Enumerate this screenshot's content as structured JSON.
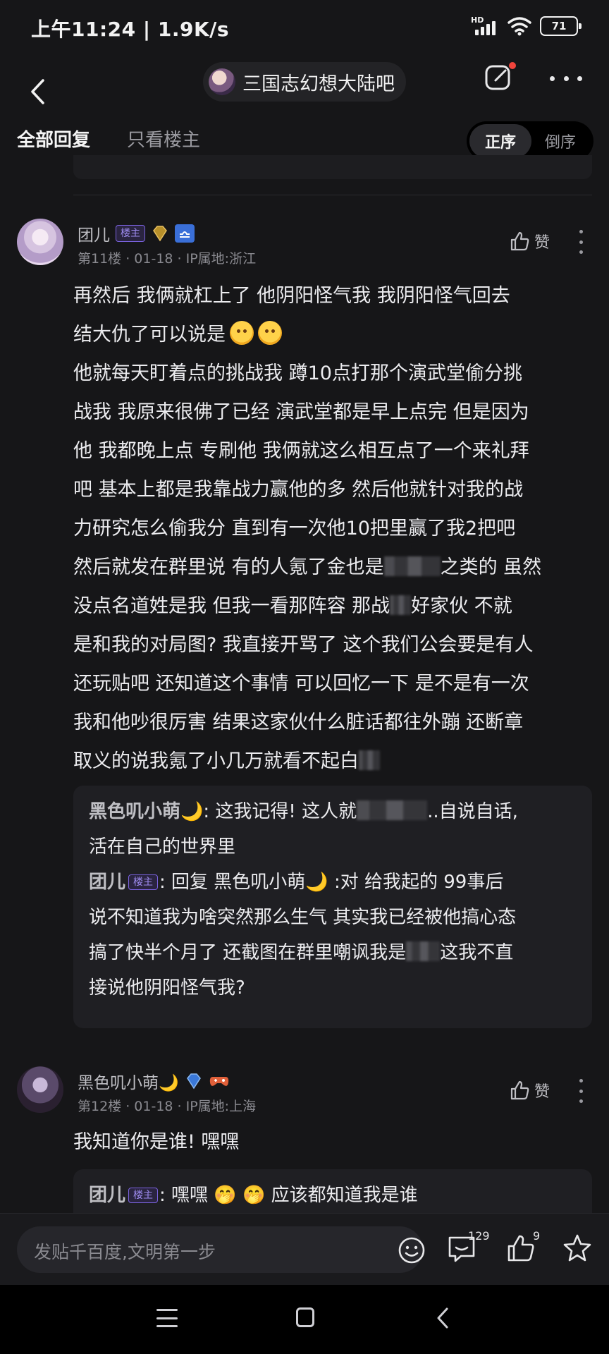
{
  "status": {
    "time_speed": "上午11:24 | 1.9K/s",
    "signal_label": "HD",
    "battery": "71"
  },
  "nav": {
    "forum_name": "三国志幻想大陆吧",
    "back_icon": "chevron-left-icon",
    "edit_icon": "edit-icon",
    "more_icon": "more-icon"
  },
  "tabs": {
    "all": "全部回复",
    "op_only": "只看楼主",
    "asc": "正序",
    "desc": "倒序"
  },
  "posts": [
    {
      "username": "团儿",
      "op_badge": "楼主",
      "meta": "第11楼 · 01-18 · IP属地:浙江",
      "like": "赞",
      "lines": [
        "再然后 我俩就杠上了 他阴阳怪气我 我阴阳怪气回去",
        "结大仇了可以说是",
        "他就每天盯着点的挑战我 蹲10点打那个演武堂偷分挑",
        "战我 我原来很佛了已经 演武堂都是早上点完 但是因为",
        "他 我都晚上点 专刷他 我俩就这么相互点了一个来礼拜",
        "吧 基本上都是我靠战力赢他的多 然后他就针对我的战",
        "力研究怎么偷我分 直到有一次他10把里赢了我2把吧",
        "然后就发在群里说 有的人氪了金也是",
        "之类的 虽然",
        "没点名道姓是我 但我一看那阵容 那战",
        "好家伙 不就",
        "是和我的对局图? 我直接开骂了 这个我们公会要是有人",
        "还玩贴吧 还知道这个事情 可以回忆一下 是不是有一次",
        "我和他吵很厉害 结果这家伙什么脏话都往外蹦 还断章",
        "取义的说我氪了小几万就看不起白"
      ],
      "replies": [
        {
          "name": "黑色叽小萌🌙",
          "text_a": ": 这我记得! 这人就",
          "text_b": "..自说自话,",
          "text_c": "活在自己的世界里"
        },
        {
          "name": "团儿",
          "badge": "楼主",
          "text_a": ": 回复 黑色叽小萌🌙 :对 给我起的 99事后",
          "text_b": "说不知道我为啥突然那么生气 其实我已经被他搞心态",
          "text_c": "搞了快半个月了 还截图在群里嘲讽我是",
          "text_d": "这我不直",
          "text_e": "接说他阴阳怪气我?"
        }
      ]
    },
    {
      "username": "黑色叽小萌🌙",
      "meta": "第12楼 · 01-18 · IP属地:上海",
      "like": "赞",
      "text": "我知道你是谁! 嘿嘿",
      "reply": {
        "name": "团儿",
        "badge": "楼主",
        "text": ": 嘿嘿 🤭 🤭 应该都知道我是谁"
      }
    }
  ],
  "bottom": {
    "placeholder": "发贴千百度,文明第一步",
    "comment_count": "129",
    "like_count": "9"
  }
}
